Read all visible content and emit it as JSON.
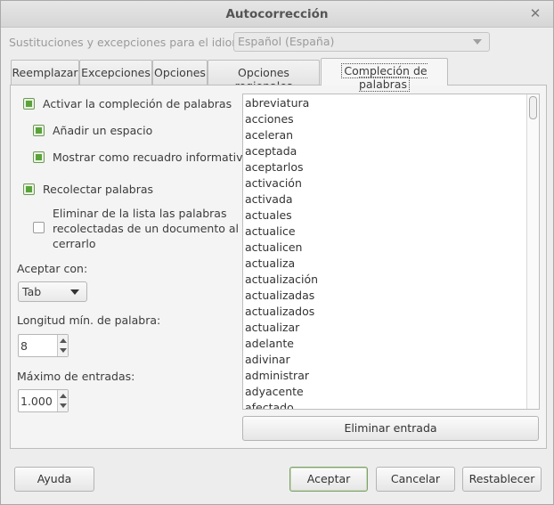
{
  "window": {
    "title": "Autocorrección"
  },
  "language": {
    "label": "Sustituciones y excepciones para el idioma:",
    "value": "Español (España)"
  },
  "tabs": [
    {
      "label": "Reemplazar"
    },
    {
      "label": "Excepciones"
    },
    {
      "label": "Opciones"
    },
    {
      "label": "Opciones regionales"
    },
    {
      "label": "Compleción de palabras"
    }
  ],
  "options": {
    "enable_completion": "Activar la compleción de palabras",
    "append_space": "Añadir un espacio",
    "show_as_tip": "Mostrar como recuadro informativo",
    "collect_words": "Recolectar palabras",
    "remove_on_close_1": "Eliminar de la lista las palabras",
    "remove_on_close_2": "recolectadas de un documento al",
    "remove_on_close_3": "cerrarlo",
    "accept_with_label": "Aceptar con:",
    "accept_with_value": "Tab",
    "min_length_label": "Longitud mín. de palabra:",
    "min_length_value": "8",
    "max_entries_label": "Máximo de entradas:",
    "max_entries_value": "1.000"
  },
  "words": [
    "abreviatura",
    "acciones",
    "aceleran",
    "aceptada",
    "aceptarlos",
    "activación",
    "activada",
    "actuales",
    "actualice",
    "actualicen",
    "actualiza",
    "actualización",
    "actualizadas",
    "actualizados",
    "actualizar",
    "adelante",
    "adivinar",
    "administrar",
    "adyacente",
    "afectado"
  ],
  "buttons": {
    "delete_entry": "Eliminar entrada",
    "help": "Ayuda",
    "ok": "Aceptar",
    "cancel": "Cancelar",
    "reset": "Restablecer"
  }
}
